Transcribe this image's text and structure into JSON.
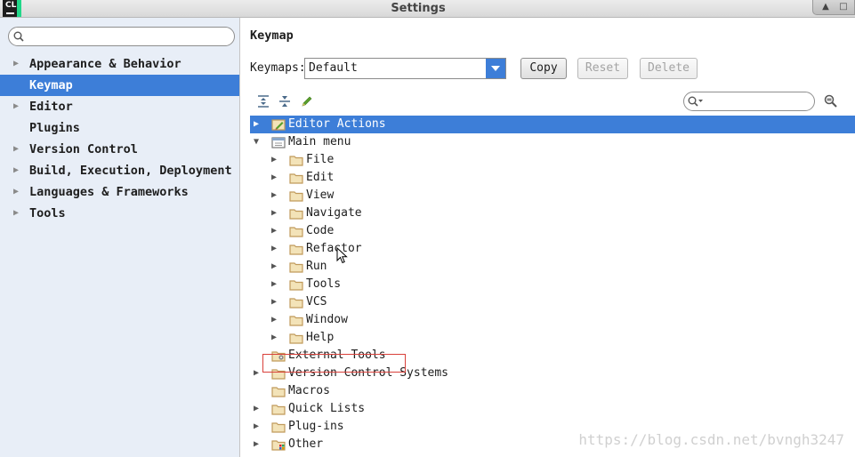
{
  "window": {
    "title": "Settings",
    "logo_text": "CL"
  },
  "sidebar": {
    "search_placeholder": "",
    "items": [
      {
        "label": "Appearance & Behavior",
        "expandable": true,
        "selected": false
      },
      {
        "label": "Keymap",
        "expandable": false,
        "selected": true
      },
      {
        "label": "Editor",
        "expandable": true,
        "selected": false
      },
      {
        "label": "Plugins",
        "expandable": false,
        "selected": false
      },
      {
        "label": "Version Control",
        "expandable": true,
        "selected": false
      },
      {
        "label": "Build, Execution, Deployment",
        "expandable": true,
        "selected": false
      },
      {
        "label": "Languages & Frameworks",
        "expandable": true,
        "selected": false
      },
      {
        "label": "Tools",
        "expandable": true,
        "selected": false
      }
    ]
  },
  "main": {
    "title": "Keymap",
    "keymaps_label": "Keymaps:",
    "keymap_value": "Default",
    "buttons": {
      "copy": "Copy",
      "reset": "Reset",
      "delete": "Delete"
    },
    "filter_placeholder": "",
    "tree": [
      {
        "label": "Editor Actions",
        "depth": 0,
        "expand": "collapsed",
        "icon": "editor-actions-icon",
        "selected": true
      },
      {
        "label": "Main menu",
        "depth": 0,
        "expand": "expanded",
        "icon": "main-menu-icon",
        "selected": false
      },
      {
        "label": "File",
        "depth": 1,
        "expand": "collapsed",
        "icon": "folder-icon",
        "selected": false
      },
      {
        "label": "Edit",
        "depth": 1,
        "expand": "collapsed",
        "icon": "folder-icon",
        "selected": false
      },
      {
        "label": "View",
        "depth": 1,
        "expand": "collapsed",
        "icon": "folder-icon",
        "selected": false
      },
      {
        "label": "Navigate",
        "depth": 1,
        "expand": "collapsed",
        "icon": "folder-icon",
        "selected": false
      },
      {
        "label": "Code",
        "depth": 1,
        "expand": "collapsed",
        "icon": "folder-icon",
        "selected": false
      },
      {
        "label": "Refactor",
        "depth": 1,
        "expand": "collapsed",
        "icon": "folder-icon",
        "selected": false
      },
      {
        "label": "Run",
        "depth": 1,
        "expand": "collapsed",
        "icon": "folder-icon",
        "selected": false,
        "highlighted": true
      },
      {
        "label": "Tools",
        "depth": 1,
        "expand": "collapsed",
        "icon": "folder-icon",
        "selected": false
      },
      {
        "label": "VCS",
        "depth": 1,
        "expand": "collapsed",
        "icon": "folder-icon",
        "selected": false
      },
      {
        "label": "Window",
        "depth": 1,
        "expand": "collapsed",
        "icon": "folder-icon",
        "selected": false
      },
      {
        "label": "Help",
        "depth": 1,
        "expand": "collapsed",
        "icon": "folder-icon",
        "selected": false
      },
      {
        "label": "External Tools",
        "depth": 0,
        "expand": "none",
        "icon": "external-tools-icon",
        "selected": false
      },
      {
        "label": "Version Control Systems",
        "depth": 0,
        "expand": "collapsed",
        "icon": "folder-icon",
        "selected": false
      },
      {
        "label": "Macros",
        "depth": 0,
        "expand": "none",
        "icon": "folder-icon",
        "selected": false
      },
      {
        "label": "Quick Lists",
        "depth": 0,
        "expand": "collapsed",
        "icon": "folder-icon",
        "selected": false
      },
      {
        "label": "Plug-ins",
        "depth": 0,
        "expand": "collapsed",
        "icon": "folder-icon",
        "selected": false
      },
      {
        "label": "Other",
        "depth": 0,
        "expand": "collapsed",
        "icon": "other-icon",
        "selected": false
      }
    ]
  },
  "watermark": "https://blog.csdn.net/bvngh3247",
  "colors": {
    "selection": "#3d7ed8",
    "sidebar_bg": "#e8eef7",
    "folder": "#c09a5b",
    "highlight_border": "#d9403a"
  }
}
